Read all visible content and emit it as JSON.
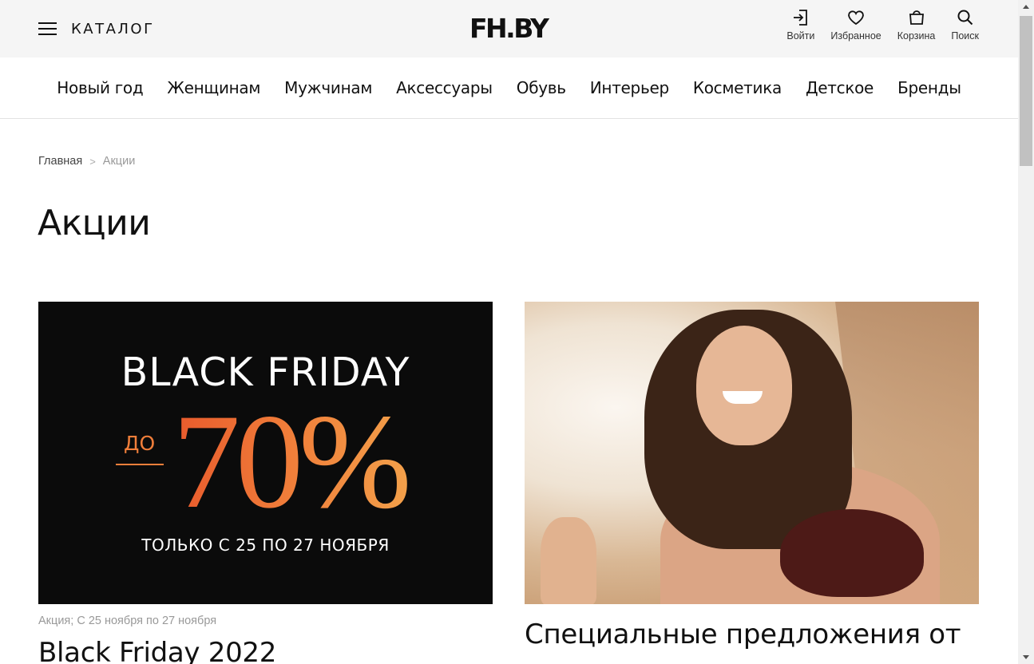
{
  "header": {
    "catalog_label": "КАТАЛОГ",
    "logo": "FH.BY",
    "actions": [
      {
        "label": "Войти",
        "icon": "login-icon"
      },
      {
        "label": "Избранное",
        "icon": "heart-icon"
      },
      {
        "label": "Корзина",
        "icon": "bag-icon"
      },
      {
        "label": "Поиск",
        "icon": "search-icon"
      }
    ]
  },
  "nav": {
    "items": [
      "Новый год",
      "Женщинам",
      "Мужчинам",
      "Аксессуары",
      "Обувь",
      "Интерьер",
      "Косметика",
      "Детское",
      "Бренды"
    ]
  },
  "breadcrumb": {
    "home": "Главная",
    "separator": ">",
    "current": "Акции"
  },
  "page": {
    "title": "Акции"
  },
  "promos": [
    {
      "meta": "Акция; С 25 ноября по 27 ноября",
      "title": "Black Friday 2022",
      "banner": {
        "headline": "BLACK FRIDAY",
        "prefix": "ДО",
        "discount": "70%",
        "dates": "ТОЛЬКО С 25 ПО 27 НОЯБРЯ",
        "accent_color": "#f07e3a",
        "background": "#0b0b0b"
      }
    },
    {
      "meta": "",
      "title": "Специальные предложения от"
    }
  ]
}
